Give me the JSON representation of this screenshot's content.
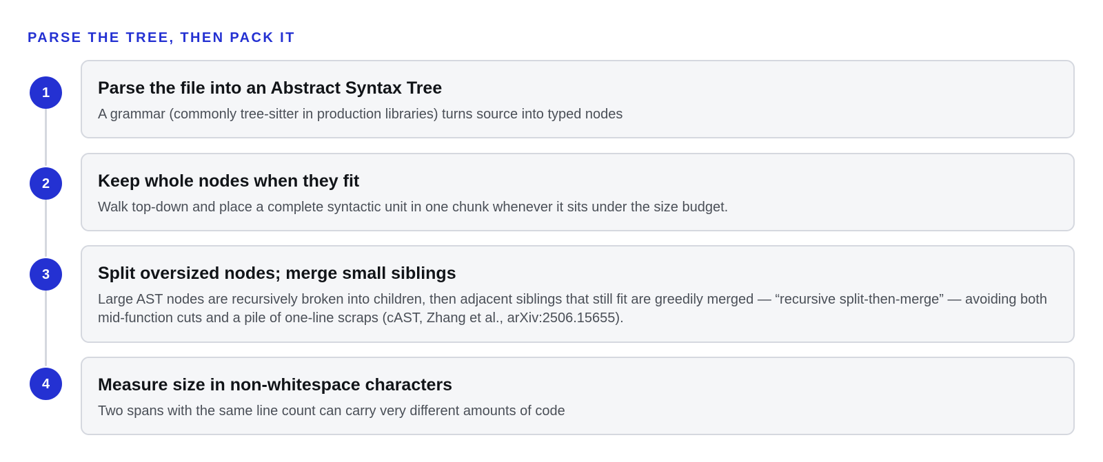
{
  "heading": "PARSE THE TREE, THEN PACK IT",
  "colors": {
    "accent": "#2431d2",
    "card_background": "#f5f6f8",
    "card_border": "#d5d8df",
    "rail": "#d5d8df",
    "title_text": "#111418",
    "body_text": "#4a4f57"
  },
  "steps": [
    {
      "number": "1",
      "title": "Parse the file into an Abstract Syntax Tree",
      "description": "A grammar (commonly tree-sitter in production libraries) turns source into typed nodes"
    },
    {
      "number": "2",
      "title": "Keep whole nodes when they fit",
      "description": "Walk top-down and place a complete syntactic unit in one chunk whenever it sits under the size budget."
    },
    {
      "number": "3",
      "title": "Split oversized nodes; merge small siblings",
      "description": "Large AST nodes are recursively broken into children, then adjacent siblings that still fit are greedily merged — “recursive split-then-merge” — avoiding both mid-function cuts and a pile of one-line scraps (cAST, Zhang et al., arXiv:2506.15655)."
    },
    {
      "number": "4",
      "title": "Measure size in non-whitespace characters",
      "description": "Two spans with the same line count can carry very different amounts of code"
    }
  ]
}
